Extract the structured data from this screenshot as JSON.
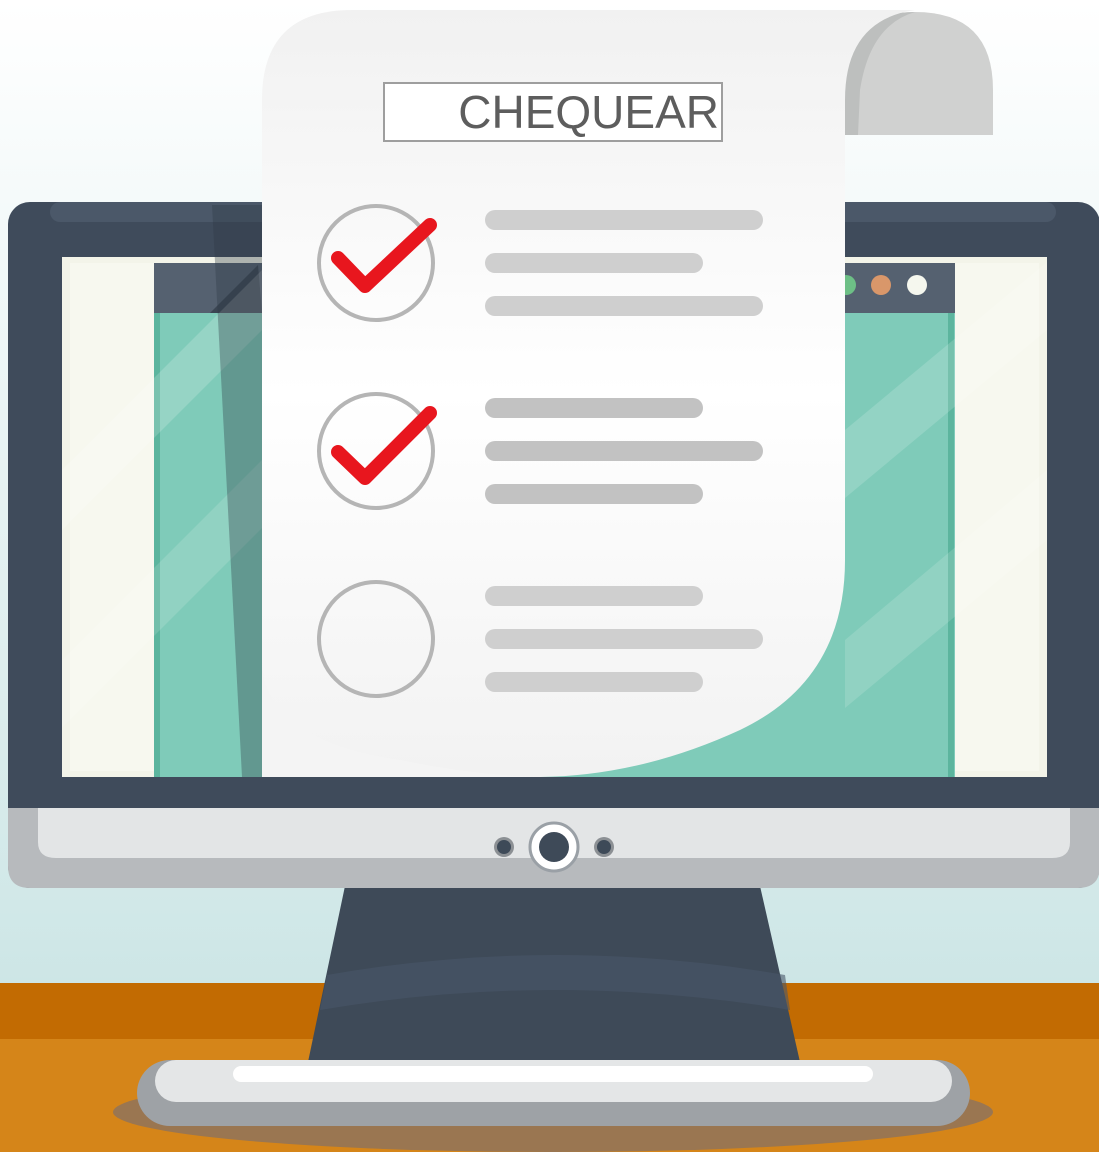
{
  "checklist": {
    "title": "CHEQUEAR",
    "items": [
      {
        "checked": true
      },
      {
        "checked": true
      },
      {
        "checked": false
      }
    ]
  },
  "colors": {
    "check_mark": "#e8161e",
    "paper": "#ffffff",
    "monitor_frame": "#3f4b5b",
    "screen_teal": "#7fcbb9",
    "desk": "#d58519"
  },
  "icons": {
    "browser_dots": [
      "green-dot-icon",
      "orange-dot-icon",
      "white-dot-icon"
    ],
    "webcam": "webcam-icon"
  }
}
